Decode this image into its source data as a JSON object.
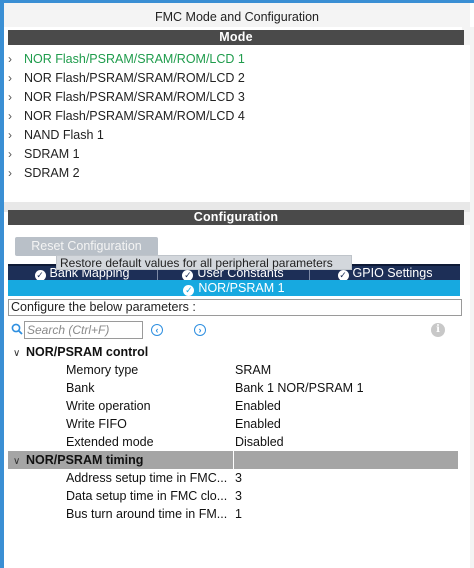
{
  "window": {
    "title": "FMC Mode and Configuration"
  },
  "mode": {
    "header": "Mode",
    "items": [
      {
        "label": "NOR Flash/PSRAM/SRAM/ROM/LCD 1",
        "active": true
      },
      {
        "label": "NOR Flash/PSRAM/SRAM/ROM/LCD 2",
        "active": false
      },
      {
        "label": "NOR Flash/PSRAM/SRAM/ROM/LCD 3",
        "active": false
      },
      {
        "label": "NOR Flash/PSRAM/SRAM/ROM/LCD 4",
        "active": false
      },
      {
        "label": "NAND Flash 1",
        "active": false
      },
      {
        "label": "SDRAM 1",
        "active": false
      },
      {
        "label": "SDRAM 2",
        "active": false
      }
    ],
    "active_color": "#1f9c4c"
  },
  "configuration": {
    "header": "Configuration",
    "reset_button": "Reset Configuration",
    "tooltip": "Restore default values for all peripheral parameters",
    "tabs": [
      {
        "label": "Bank Mapping"
      },
      {
        "label": "User Constants"
      },
      {
        "label": "GPIO Settings"
      }
    ],
    "active_tab": "NOR/PSRAM 1",
    "configure_label": "Configure the below parameters :",
    "search": {
      "placeholder": "Search (Ctrl+F)"
    },
    "groups": [
      {
        "label": "NOR/PSRAM control",
        "params": [
          {
            "name": "Memory type",
            "value": "SRAM"
          },
          {
            "name": "Bank",
            "value": "Bank 1 NOR/PSRAM 1"
          },
          {
            "name": "Write operation",
            "value": "Enabled"
          },
          {
            "name": "Write FIFO",
            "value": "Enabled"
          },
          {
            "name": "Extended mode",
            "value": "Disabled"
          }
        ]
      },
      {
        "label": "NOR/PSRAM timing",
        "params": [
          {
            "name": "Address setup time in FMC...",
            "value": "3"
          },
          {
            "name": "Data setup time in FMC clo...",
            "value": "3"
          },
          {
            "name": "Bus turn around time in FM...",
            "value": "1"
          }
        ]
      }
    ]
  },
  "colors": {
    "section_header": "#4a4a4a",
    "tabs_bg": "#1d2f57",
    "active_tab_bg": "#17a9e0",
    "frame_accent": "#3a8fd4"
  }
}
